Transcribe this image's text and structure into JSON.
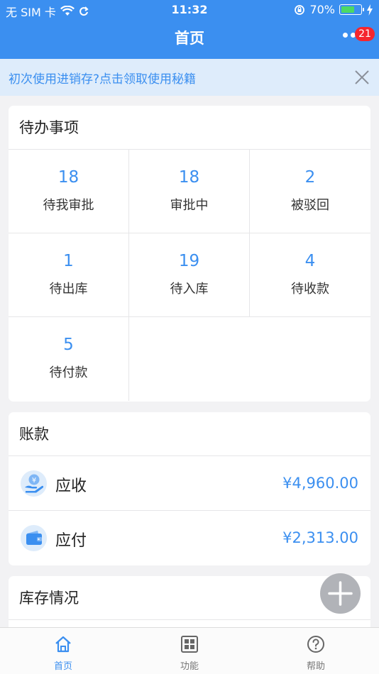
{
  "status_bar": {
    "carrier": "无 SIM 卡",
    "time": "11:32",
    "battery_percent_text": "70%",
    "battery_level": 0.7
  },
  "nav": {
    "title": "首页",
    "badge_count": "21"
  },
  "tip": {
    "text": "初次使用进销存?点击领取使用秘籍"
  },
  "todo": {
    "title": "待办事项",
    "items": [
      {
        "count": "18",
        "label": "待我审批"
      },
      {
        "count": "18",
        "label": "审批中"
      },
      {
        "count": "2",
        "label": "被驳回"
      },
      {
        "count": "1",
        "label": "待出库"
      },
      {
        "count": "19",
        "label": "待入库"
      },
      {
        "count": "4",
        "label": "待收款"
      },
      {
        "count": "5",
        "label": "待付款"
      }
    ]
  },
  "accounts": {
    "title": "账款",
    "rows": [
      {
        "label": "应收",
        "amount": "¥4,960.00",
        "icon": "receivable-hand-yen-icon"
      },
      {
        "label": "应付",
        "amount": "¥2,313.00",
        "icon": "wallet-icon"
      }
    ]
  },
  "inventory": {
    "title": "库存情况"
  },
  "tabbar": {
    "tabs": [
      {
        "label": "首页",
        "icon": "home-icon",
        "active": true
      },
      {
        "label": "功能",
        "icon": "grid-icon",
        "active": false
      },
      {
        "label": "帮助",
        "icon": "help-icon",
        "active": false
      }
    ]
  },
  "colors": {
    "primary": "#3b8ff0",
    "badge": "#f5262e",
    "tip_bg": "#deecfb",
    "page_bg": "#f2f2f4",
    "fab": "#b1b3b8"
  }
}
